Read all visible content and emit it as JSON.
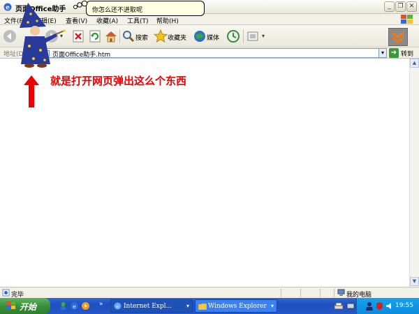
{
  "window": {
    "title": "页面Office助手"
  },
  "menu": {
    "items": [
      "文件(F)",
      "编辑(E)",
      "查看(V)",
      "收藏(A)",
      "工具(T)",
      "帮助(H)"
    ]
  },
  "toolbar": {
    "search_label": "搜索",
    "favorites_label": "收藏夹",
    "media_label": "媒体"
  },
  "address": {
    "label": "地址(D)",
    "url": "页面Office助手.htm",
    "go_label": "转到"
  },
  "assistant": {
    "balloon_text": "你怎么还不进取呢"
  },
  "content": {
    "annotation_text": "就是打开网页弹出这么个东西"
  },
  "status": {
    "text": "完毕",
    "zone": "我的电脑"
  },
  "taskbar": {
    "start_label": "开始",
    "tasks": [
      {
        "label": "Internet Expl..."
      },
      {
        "label": "Windows Explorer"
      }
    ],
    "clock": "19:55"
  },
  "colors": {
    "annotation": "#ee0000",
    "taskbar": "#245edb",
    "start": "#3a8f3a"
  }
}
